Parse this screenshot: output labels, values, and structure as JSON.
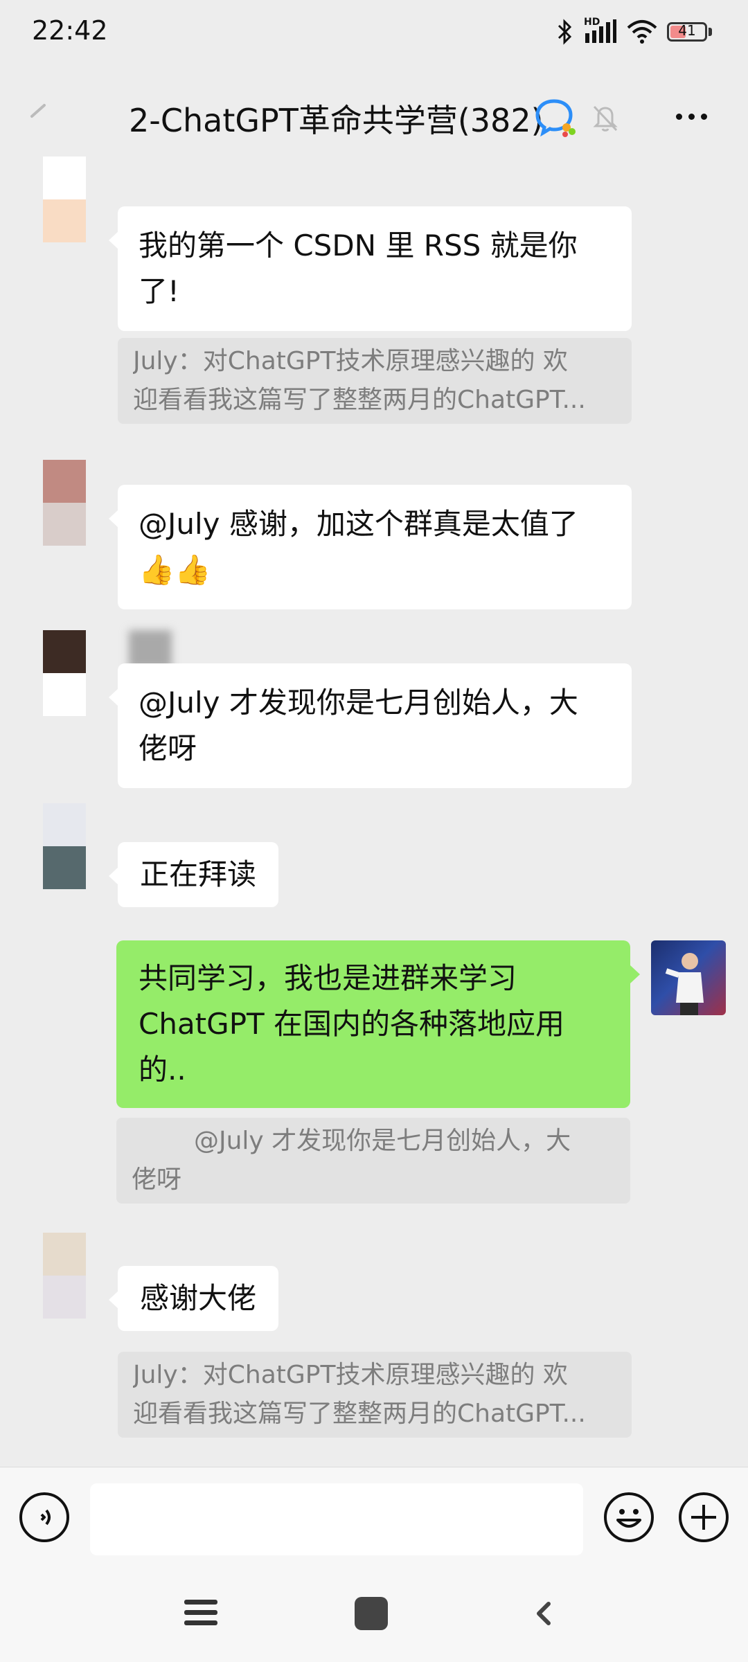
{
  "status_bar": {
    "time": "22:42",
    "network": "HD",
    "battery": "41",
    "icons": [
      "bluetooth-icon",
      "signal-icon",
      "wifi-icon",
      "battery-icon"
    ]
  },
  "header": {
    "title": "2-ChatGPT革命共学营(382)",
    "icons": [
      "back-icon",
      "chat-bubble-icon",
      "mute-bell-icon",
      "more-icon"
    ]
  },
  "messages": [
    {
      "lines": [
        "我的第一个 CSDN 里 RSS 就是你",
        "了!"
      ]
    },
    {
      "quote_lines": [
        "July：对ChatGPT技术原理感兴趣的  欢",
        "迎看看我这篇写了整整两月的ChatGPT..."
      ]
    },
    {
      "lines": [
        "@July 感谢，加这个群真是太值了",
        "👍👍"
      ]
    },
    {
      "lines": [
        "@July 才发现你是七月创始人，大",
        "佬呀"
      ]
    },
    {
      "lines": [
        "正在拜读"
      ]
    },
    {
      "lines": [
        "共同学习，我也是进群来学习",
        "ChatGPT 在国内的各种落地应用",
        "的.."
      ]
    },
    {
      "quote_lines": [
        "@July 才发现你是七月创始人，大",
        "佬呀"
      ]
    },
    {
      "lines": [
        "感谢大佬"
      ]
    },
    {
      "quote_lines": [
        "July：对ChatGPT技术原理感兴趣的  欢",
        "迎看看我这篇写了整整两月的ChatGPT..."
      ]
    }
  ],
  "colors": {
    "background": "#ededed",
    "self_bubble": "#95ec69",
    "other_bubble": "#ffffff",
    "quote_bg": "#e2e2e2"
  },
  "input_bar": {
    "icons": [
      "voice-icon",
      "emoji-icon",
      "plus-icon"
    ]
  },
  "nav_bar": {
    "icons": [
      "menu-icon",
      "home-icon",
      "back-arrow-icon"
    ]
  }
}
